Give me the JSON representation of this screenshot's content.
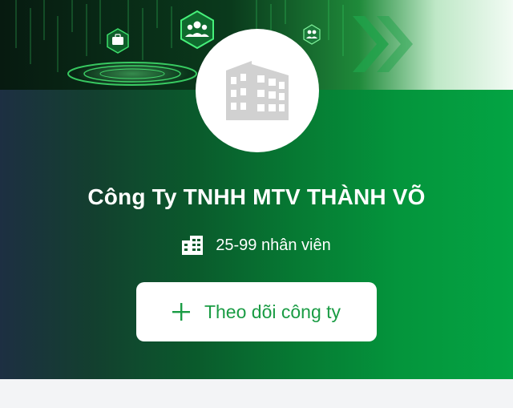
{
  "company": {
    "name": "Công Ty TNHH MTV THÀNH VÕ",
    "logo_icon": "building-icon",
    "employees_label": "25-99 nhân viên",
    "employees_icon": "building-icon"
  },
  "actions": {
    "follow_label": "Theo dõi công ty",
    "follow_icon": "plus-icon"
  },
  "banner": {
    "icons": [
      "briefcase-icon",
      "people-group-icon",
      "people-icon"
    ]
  },
  "colors": {
    "gradient_start": "#1d2f42",
    "gradient_end": "#03a443",
    "accent_green": "#1a9c44",
    "button_bg": "#ffffff",
    "text_light": "#ffffff"
  }
}
